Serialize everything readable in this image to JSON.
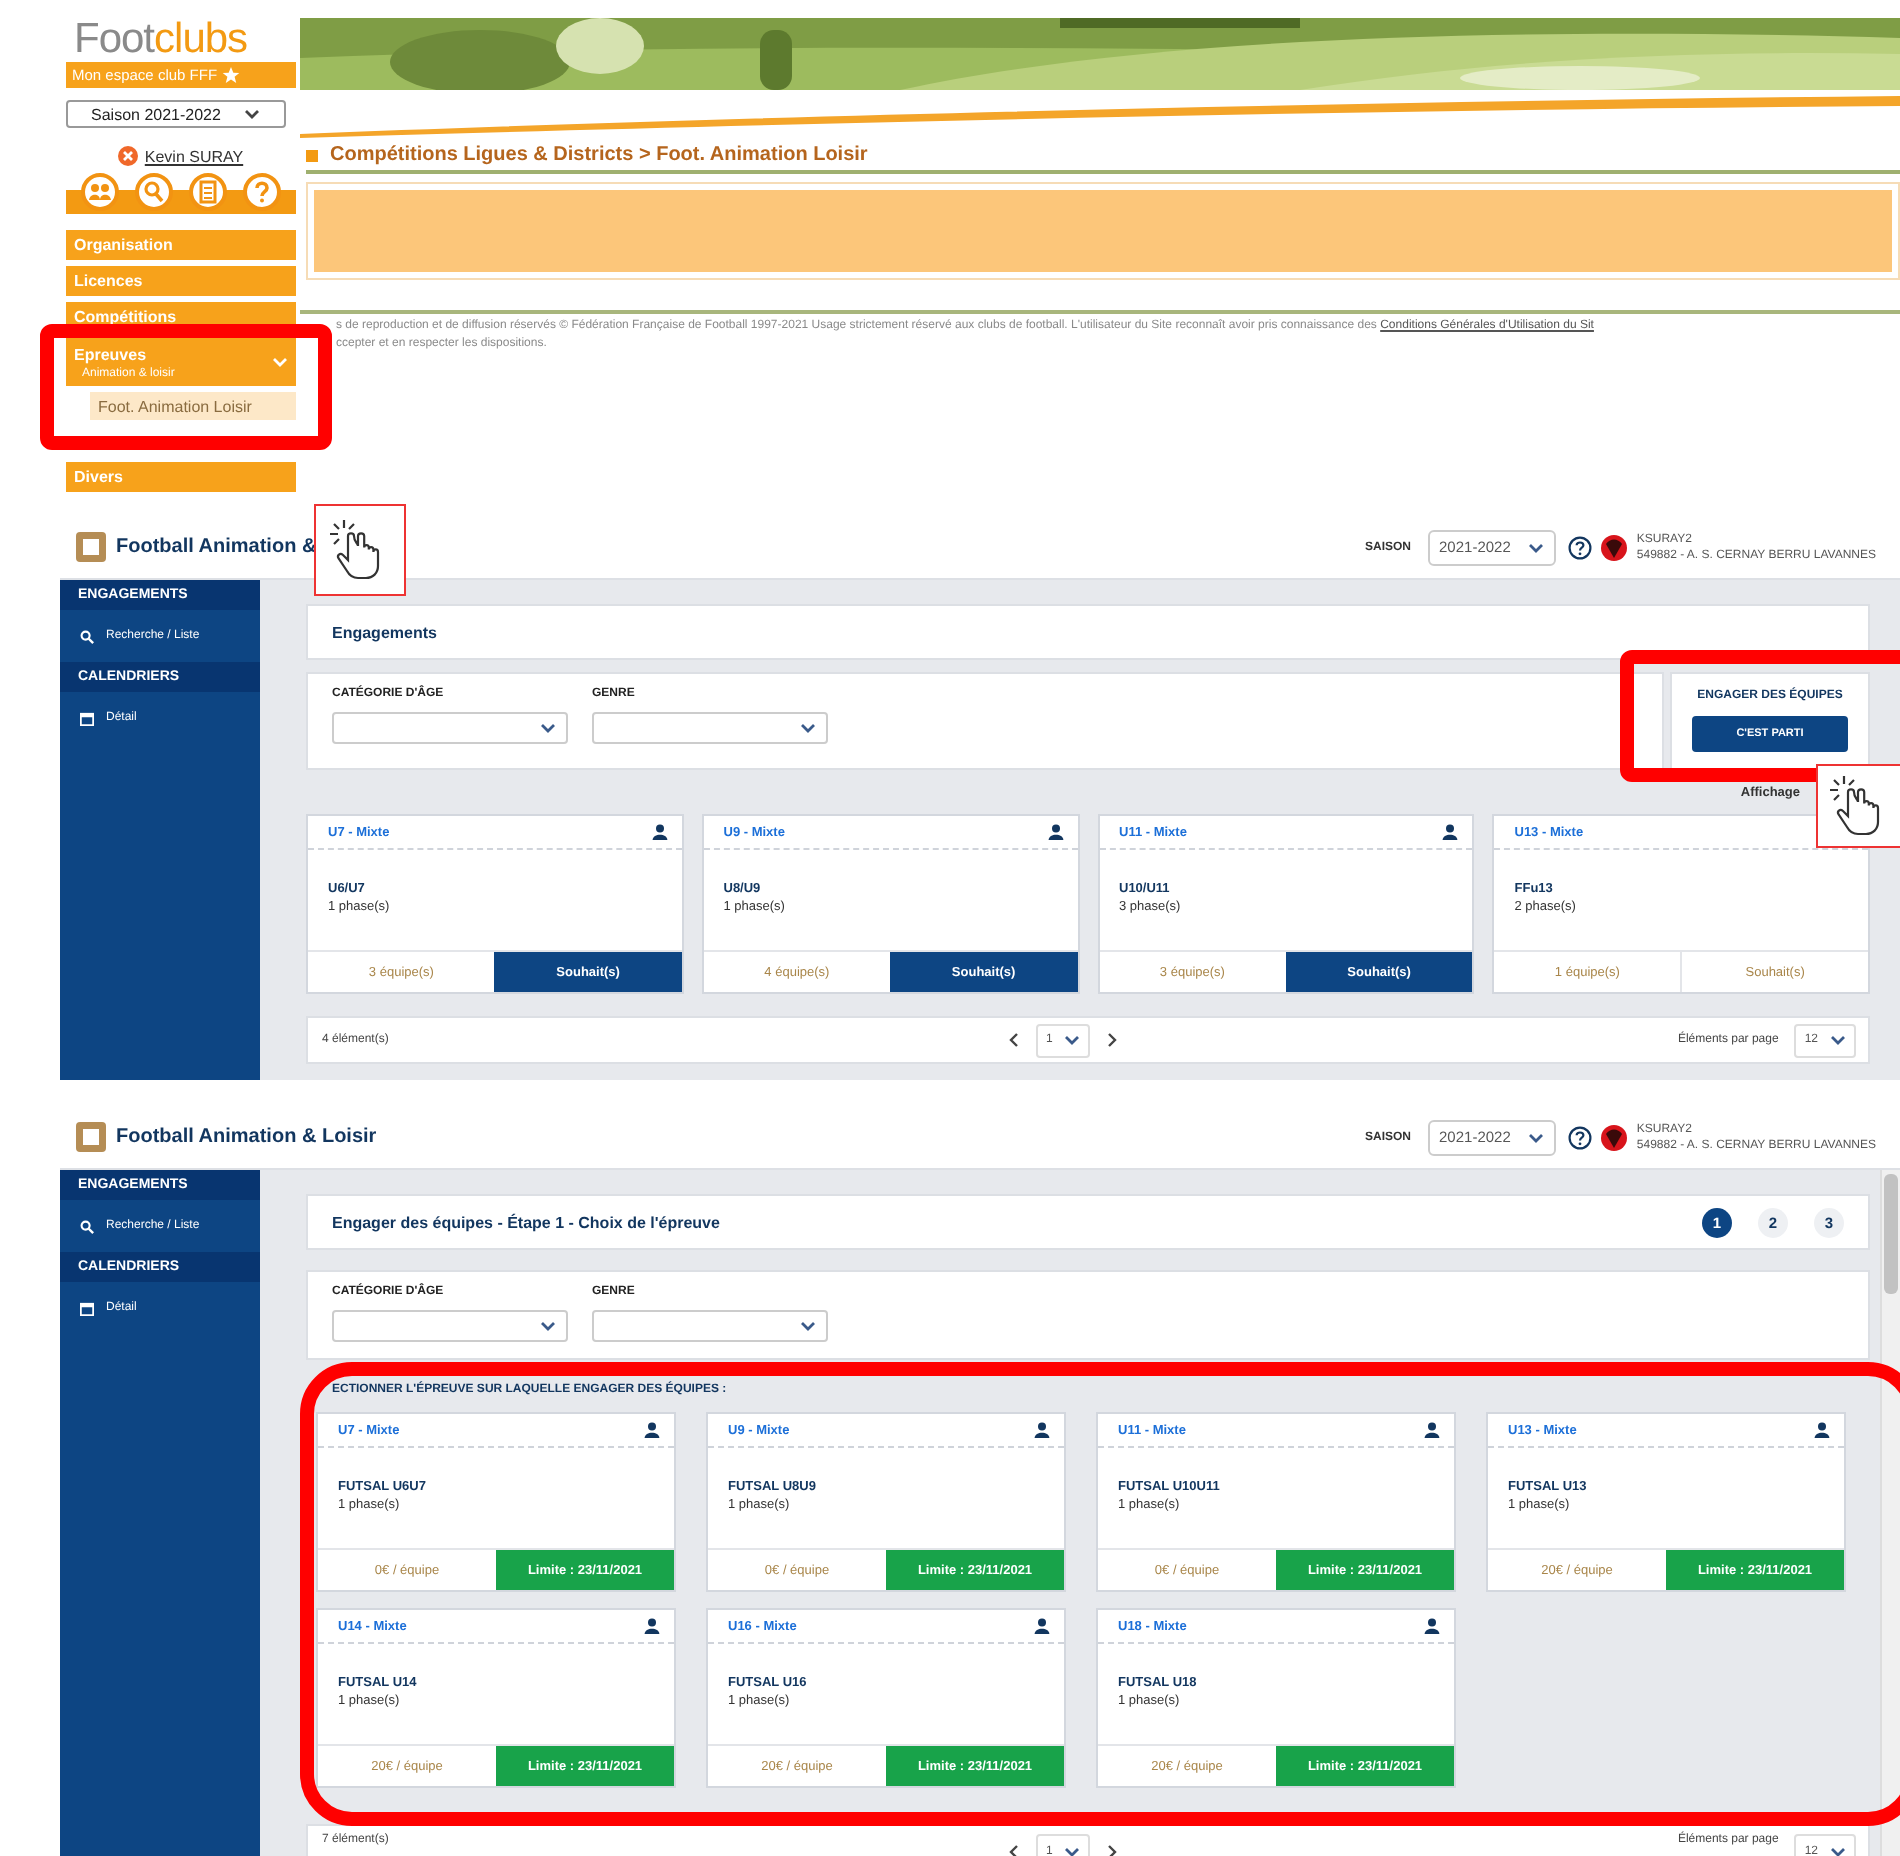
{
  "legacy": {
    "logo": {
      "word_start": "Foot",
      "word_end": "clubs",
      "tagline": "Mon espace club FFF"
    },
    "season_select": "Saison 2021-2022",
    "user": "Kevin SURAY",
    "menu": [
      {
        "label": "Organisation",
        "expanded": false
      },
      {
        "label": "Licences",
        "expanded": false
      },
      {
        "label": "Compétitions",
        "expanded": false
      },
      {
        "label": "Epreuves",
        "sublabel": "Animation & loisir",
        "expanded": true,
        "children": [
          {
            "label": "Foot. Animation Loisir",
            "selected": true
          }
        ]
      },
      {
        "label": "Divers",
        "expanded": false
      }
    ],
    "breadcrumb": "Compétitions Ligues & Districts > Foot. Animation Loisir",
    "notice": {
      "text_before": "s de reproduction et de diffusion réservés © Fédération Française de Football 1997-2021 Usage strictement réservé aux clubs de football. L'utilisateur du Site reconnaît avoir pris connaissance des",
      "link": "Conditions Générales d'Utilisation du Sit",
      "text_after": "ccepter et en respecter les dispositions."
    }
  },
  "panels": [
    {
      "title": "Football Animation &",
      "season_label": "SAISON",
      "season": "2021-2022",
      "user": "KSURAY2",
      "club": "549882 - A. S. CERNAY BERRU LAVANNES",
      "sidebar": [
        {
          "kind": "header",
          "label": "ENGAGEMENTS"
        },
        {
          "kind": "search",
          "label": "Recherche / Liste"
        },
        {
          "kind": "header",
          "label": "CALENDRIERS"
        },
        {
          "kind": "calendar",
          "label": "Détail"
        }
      ],
      "heading": "Engagements",
      "filters": [
        {
          "label": "CATÉGORIE D'ÂGE"
        },
        {
          "label": "GENRE"
        }
      ],
      "engage": {
        "title": "ENGAGER DES ÉQUIPES",
        "button": "C'EST PARTI"
      },
      "display_label": "Affichage",
      "cards": [
        {
          "category": "U7 - Mixte",
          "name": "U6/U7",
          "phases": "1 phase(s)",
          "info": "3 équipe(s)",
          "action": "Souhait(s)",
          "kind": "request",
          "active": true
        },
        {
          "category": "U9 - Mixte",
          "name": "U8/U9",
          "phases": "1 phase(s)",
          "info": "4 équipe(s)",
          "action": "Souhait(s)",
          "kind": "request",
          "active": true
        },
        {
          "category": "U11 - Mixte",
          "name": "U10/U11",
          "phases": "3 phase(s)",
          "info": "3 équipe(s)",
          "action": "Souhait(s)",
          "kind": "request",
          "active": true
        },
        {
          "category": "U13 - Mixte",
          "name": "FFu13",
          "phases": "2 phase(s)",
          "info": "1 équipe(s)",
          "action": "Souhait(s)",
          "kind": "request",
          "active": false
        }
      ],
      "pagination": {
        "count": "4 élément(s)",
        "page": "1",
        "per_page_label": "Éléments par page",
        "per_page": "12"
      }
    },
    {
      "title": "Football Animation & Loisir",
      "season_label": "SAISON",
      "season": "2021-2022",
      "user": "KSURAY2",
      "club": "549882 - A. S. CERNAY BERRU LAVANNES",
      "sidebar": [
        {
          "kind": "header",
          "label": "ENGAGEMENTS"
        },
        {
          "kind": "search",
          "label": "Recherche / Liste"
        },
        {
          "kind": "header",
          "label": "CALENDRIERS"
        },
        {
          "kind": "calendar",
          "label": "Détail"
        }
      ],
      "heading": "Engager des équipes - Étape 1 - Choix de l'épreuve",
      "steps": [
        {
          "label": "1",
          "selected": true
        },
        {
          "label": "2",
          "selected": false
        },
        {
          "label": "3",
          "selected": false
        }
      ],
      "filters": [
        {
          "label": "CATÉGORIE D'ÂGE"
        },
        {
          "label": "GENRE"
        }
      ],
      "section_label": "ECTIONNER L'ÉPREUVE SUR LAQUELLE ENGAGER DES ÉQUIPES :",
      "cards": [
        {
          "category": "U7 - Mixte",
          "name": "FUTSAL U6U7",
          "phases": "1 phase(s)",
          "info": "0€ / équipe",
          "action": "Limite : 23/11/2021",
          "kind": "deadline"
        },
        {
          "category": "U9 - Mixte",
          "name": "FUTSAL U8U9",
          "phases": "1 phase(s)",
          "info": "0€ / équipe",
          "action": "Limite : 23/11/2021",
          "kind": "deadline"
        },
        {
          "category": "U11 - Mixte",
          "name": "FUTSAL U10U11",
          "phases": "1 phase(s)",
          "info": "0€ / équipe",
          "action": "Limite : 23/11/2021",
          "kind": "deadline"
        },
        {
          "category": "U13 - Mixte",
          "name": "FUTSAL U13",
          "phases": "1 phase(s)",
          "info": "20€ / équipe",
          "action": "Limite : 23/11/2021",
          "kind": "deadline"
        },
        {
          "category": "U14 - Mixte",
          "name": "FUTSAL U14",
          "phases": "1 phase(s)",
          "info": "20€ / équipe",
          "action": "Limite : 23/11/2021",
          "kind": "deadline"
        },
        {
          "category": "U16 - Mixte",
          "name": "FUTSAL U16",
          "phases": "1 phase(s)",
          "info": "20€ / équipe",
          "action": "Limite : 23/11/2021",
          "kind": "deadline"
        },
        {
          "category": "U18 - Mixte",
          "name": "FUTSAL U18",
          "phases": "1 phase(s)",
          "info": "20€ / équipe",
          "action": "Limite : 23/11/2021",
          "kind": "deadline"
        }
      ],
      "pagination": {
        "count": "7 élément(s)",
        "page": "1",
        "per_page_label": "Éléments par page",
        "per_page": "12"
      }
    }
  ]
}
